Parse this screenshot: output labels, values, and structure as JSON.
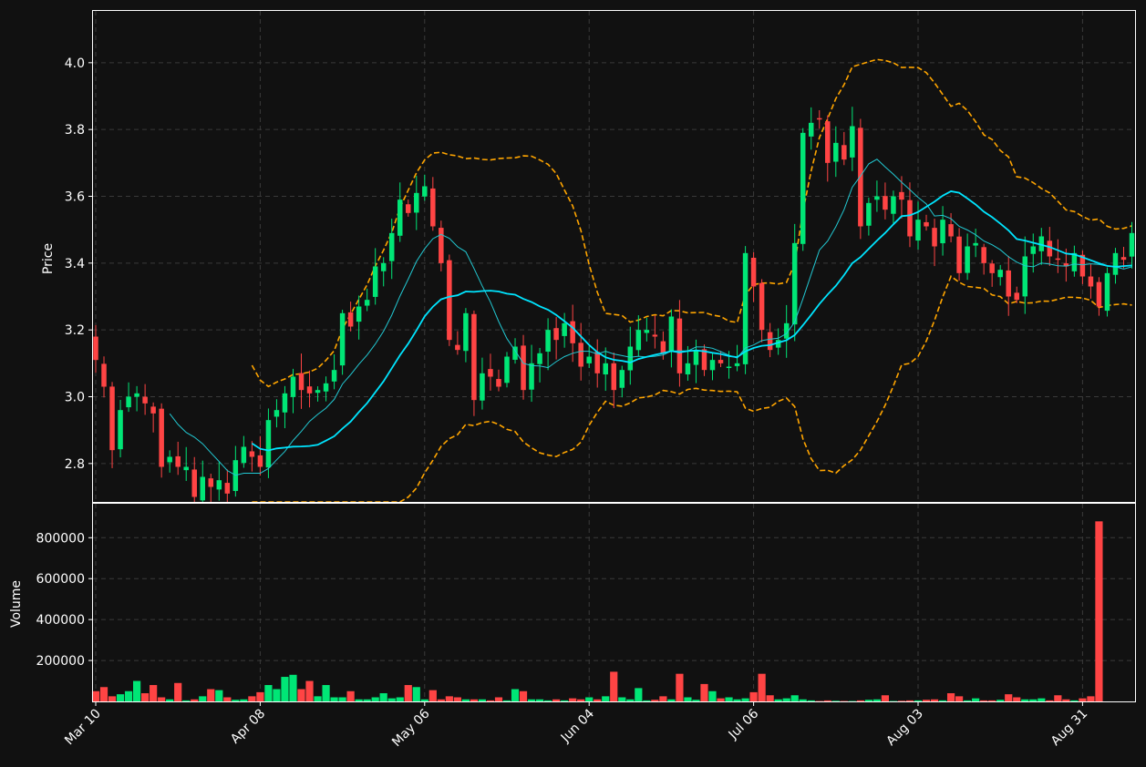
{
  "chart_data": {
    "type": "candlestick",
    "x_tick_labels": [
      "Mar 10",
      "Apr 08",
      "May 06",
      "Jun 04",
      "Jul 06",
      "Aug 03",
      "Aug 31"
    ],
    "x_tick_index": [
      0,
      20,
      40,
      60,
      80,
      100,
      120
    ],
    "price_axis": {
      "label": "Price",
      "ylim": [
        2.685,
        4.155
      ],
      "ticks": [
        2.8,
        3.0,
        3.2,
        3.4,
        3.6,
        3.8,
        4.0
      ]
    },
    "volume_axis": {
      "label": "Volume",
      "ylim": [
        0,
        966000
      ],
      "ticks": [
        200000,
        400000,
        600000,
        800000
      ],
      "tick_labels": [
        "200000",
        "400000",
        "600000",
        "800000"
      ]
    },
    "grid": true,
    "colors": {
      "up": "#00e676",
      "down": "#ff4444",
      "ma_fast": "#22c8d2",
      "ma_slow": "#00e5ff",
      "bands": "#ffa500",
      "background": "#111111",
      "grid": "#3a3a3a"
    },
    "close": [
      3.11,
      3.03,
      2.84,
      2.96,
      3.0,
      3.01,
      2.98,
      2.95,
      2.79,
      2.82,
      2.79,
      2.79,
      2.7,
      2.76,
      2.73,
      2.75,
      2.71,
      2.81,
      2.85,
      2.82,
      2.79,
      2.93,
      2.96,
      3.01,
      3.06,
      3.02,
      3.01,
      3.02,
      3.04,
      3.08,
      3.25,
      3.21,
      3.27,
      3.29,
      3.39,
      3.4,
      3.49,
      3.59,
      3.55,
      3.61,
      3.63,
      3.51,
      3.4,
      3.17,
      3.14,
      3.25,
      2.99,
      3.07,
      3.06,
      3.03,
      3.12,
      3.15,
      3.02,
      3.1,
      3.13,
      3.2,
      3.17,
      3.22,
      3.16,
      3.09,
      3.12,
      3.07,
      3.1,
      3.02,
      3.08,
      3.15,
      3.2,
      3.2,
      3.18,
      3.13,
      3.24,
      3.07,
      3.1,
      3.14,
      3.08,
      3.11,
      3.1,
      3.09,
      3.1,
      3.43,
      3.33,
      3.2,
      3.14,
      3.17,
      3.22,
      3.46,
      3.79,
      3.82,
      3.83,
      3.7,
      3.76,
      3.71,
      3.81,
      3.51,
      3.58,
      3.6,
      3.56,
      3.6,
      3.59,
      3.48,
      3.53,
      3.51,
      3.45,
      3.53,
      3.48,
      3.37,
      3.45,
      3.46,
      3.4,
      3.37,
      3.38,
      3.3,
      3.29,
      3.42,
      3.45,
      3.48,
      3.42,
      3.41,
      3.39,
      3.43,
      3.36,
      3.33,
      3.27,
      3.37,
      3.43,
      3.41,
      3.49
    ],
    "volume": [
      50000,
      70000,
      25000,
      35000,
      50000,
      100000,
      40000,
      80000,
      20000,
      10000,
      90000,
      5000,
      10000,
      25000,
      60000,
      55000,
      20000,
      8000,
      10000,
      25000,
      45000,
      80000,
      60000,
      120000,
      130000,
      60000,
      100000,
      25000,
      80000,
      20000,
      20000,
      50000,
      10000,
      10000,
      20000,
      40000,
      15000,
      20000,
      80000,
      70000,
      10000,
      55000,
      10000,
      25000,
      20000,
      10000,
      10000,
      10000,
      5000,
      20000,
      5000,
      60000,
      50000,
      10000,
      10000,
      5000,
      10000,
      5000,
      15000,
      10000,
      20000,
      10000,
      25000,
      145000,
      20000,
      10000,
      65000,
      5000,
      8000,
      25000,
      10000,
      135000,
      20000,
      8000,
      85000,
      50000,
      15000,
      20000,
      10000,
      15000,
      45000,
      135000,
      30000,
      10000,
      15000,
      30000,
      10000,
      5000,
      2000,
      5000,
      3000,
      2000,
      2000,
      5000,
      8000,
      10000,
      30000,
      2000,
      3000,
      5000,
      5000,
      8000,
      10000,
      5000,
      40000,
      25000,
      5000,
      15000,
      5000,
      5000,
      8000,
      35000,
      20000,
      10000,
      10000,
      15000,
      5000,
      30000,
      10000,
      5000,
      15000,
      25000,
      880000
    ]
  }
}
